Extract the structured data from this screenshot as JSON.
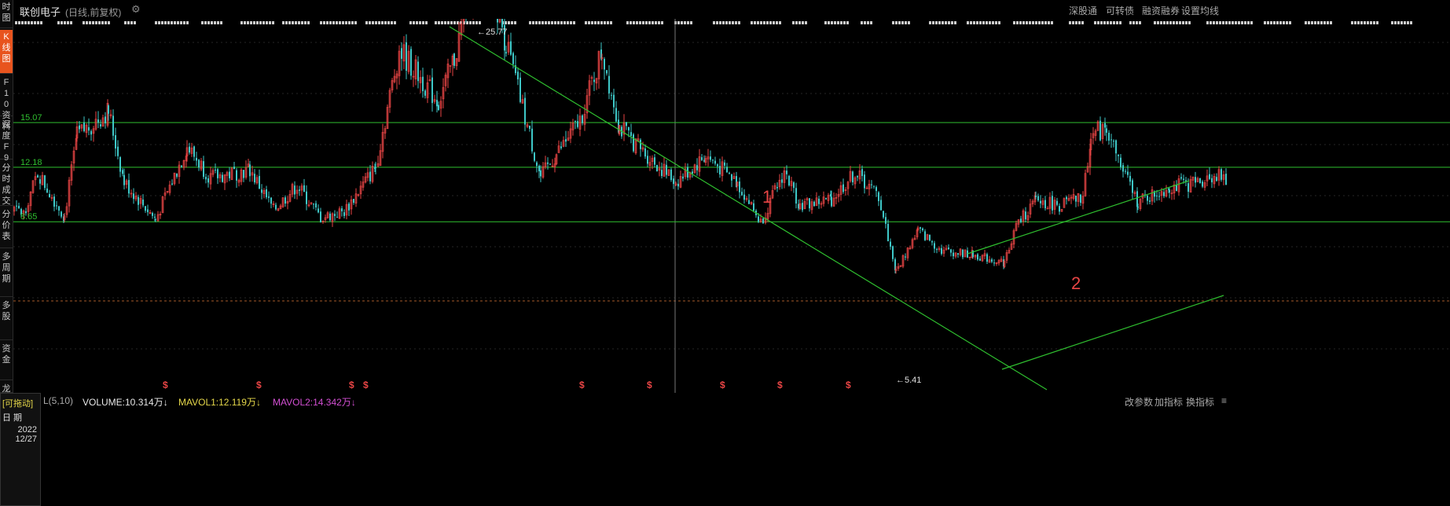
{
  "window": {
    "stock_name": "联创电子",
    "mode": "(日线,前复权)"
  },
  "sidebar": {
    "tabs": [
      {
        "label": "时图",
        "active": false
      },
      {
        "label": "K线图",
        "active": true
      },
      {
        "label": "F10资料",
        "active": false
      },
      {
        "label": "深度F9",
        "active": false
      },
      {
        "label": "分时成交",
        "active": false
      },
      {
        "label": "分价表",
        "active": false
      },
      {
        "label": "多周期",
        "active": false
      },
      {
        "label": "多股",
        "active": false
      },
      {
        "label": "资金",
        "active": false
      },
      {
        "label": "龙",
        "active": false
      }
    ]
  },
  "toolbar": {
    "links": [
      "深股通",
      "可转债",
      "融资融券",
      "设置均线"
    ]
  },
  "chart_data": {
    "type": "candlestick",
    "price_levels": [
      {
        "label": "15.07",
        "value": 15.07
      },
      {
        "label": "12.18",
        "value": 12.18
      },
      {
        "label": "8.65",
        "value": 8.65
      }
    ],
    "max_marker": "25.77",
    "min_marker": "5.41",
    "annotations": [
      "1",
      "2"
    ],
    "signal_glyph": "$",
    "colors": {
      "up": "#e84545",
      "down": "#3ec8c8",
      "level": "#2fbf2f",
      "trend": "#2fbf2f",
      "annotation": "#e84545"
    }
  },
  "volume_bar": {
    "indicator": "L(5,10)",
    "volume": "VOLUME:10.314万",
    "mavol1": "MAVOL1:12.119万",
    "mavol2": "MAVOL2:14.342万",
    "arrow": "↓",
    "right_links": [
      "改参数",
      "加指标",
      "换指标"
    ],
    "expand": "≡"
  },
  "drag_box": {
    "label": "[可拖动]",
    "date_label": "日 期",
    "year": "2022",
    "md": "12/27"
  }
}
